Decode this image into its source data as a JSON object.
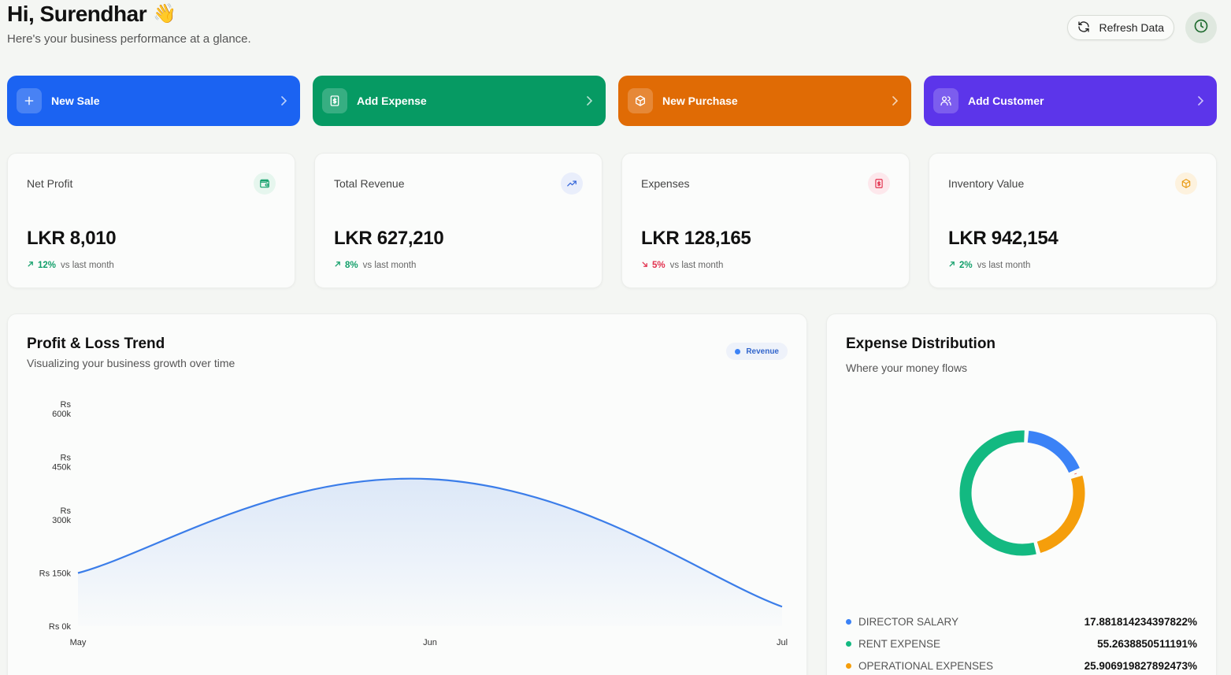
{
  "header": {
    "greeting": "Hi, Surendhar",
    "wave": "👋",
    "subtitle": "Here's your business performance at a glance.",
    "refresh_label": "Refresh Data"
  },
  "quick_actions": [
    {
      "label": "New Sale",
      "color": "#1b63f2",
      "icon": "plus-icon"
    },
    {
      "label": "Add Expense",
      "color": "#069a63",
      "icon": "receipt-icon"
    },
    {
      "label": "New Purchase",
      "color": "#e06b05",
      "icon": "package-icon"
    },
    {
      "label": "Add Customer",
      "color": "#5c35ea",
      "icon": "users-icon"
    }
  ],
  "stats": [
    {
      "title": "Net Profit",
      "value": "LKR 8,010",
      "change": "12%",
      "direction": "up",
      "suffix": "vs last month",
      "icon": "wallet-icon",
      "accent": "#13a06b"
    },
    {
      "title": "Total Revenue",
      "value": "LKR 627,210",
      "change": "8%",
      "direction": "up",
      "suffix": "vs last month",
      "icon": "trending-up-icon",
      "accent": "#2f62d8"
    },
    {
      "title": "Expenses",
      "value": "LKR 128,165",
      "change": "5%",
      "direction": "down",
      "suffix": "vs last month",
      "icon": "receipt-icon",
      "accent": "#e2314e"
    },
    {
      "title": "Inventory Value",
      "value": "LKR 942,154",
      "change": "2%",
      "direction": "up",
      "suffix": "vs last month",
      "icon": "package-icon",
      "accent": "#e89a12"
    }
  ],
  "pl_card": {
    "title": "Profit & Loss Trend",
    "subtitle": "Visualizing your business growth over time",
    "legend": "Revenue"
  },
  "exp_card": {
    "title": "Expense Distribution",
    "subtitle": "Where your money flows"
  },
  "chart_data": [
    {
      "type": "area",
      "title": "Profit & Loss Trend",
      "categories": [
        "May",
        "Jun",
        "Jul"
      ],
      "series": [
        {
          "name": "Revenue",
          "values": [
            150000,
            415000,
            55000
          ],
          "color": "#3b7de9"
        }
      ],
      "ylim": [
        0,
        600000
      ],
      "yticks": [
        {
          "value": 0,
          "label": "Rs 0k"
        },
        {
          "value": 150000,
          "label": "Rs 150k"
        },
        {
          "value": 300000,
          "label": "Rs 300k"
        },
        {
          "value": 450000,
          "label": "Rs 450k"
        },
        {
          "value": 600000,
          "label": "Rs 600k"
        }
      ],
      "grid": false,
      "legend": "top-right"
    },
    {
      "type": "pie",
      "title": "Expense Distribution",
      "slices": [
        {
          "label": "DIRECTOR SALARY",
          "value": 17.881814234397822,
          "display": "17.881814234397822%",
          "color": "#3b82f6"
        },
        {
          "label": "RENT EXPENSE",
          "value": 55.2638850511191,
          "display": "55.2638850511191%",
          "color": "#13b981"
        },
        {
          "label": "OPERATIONAL EXPENSES",
          "value": 25.906919827892473,
          "display": "25.906919827892473%",
          "color": "#f59e0b"
        },
        {
          "label": "",
          "value": 0.95,
          "display": "",
          "color": "#ef4444"
        }
      ]
    }
  ]
}
